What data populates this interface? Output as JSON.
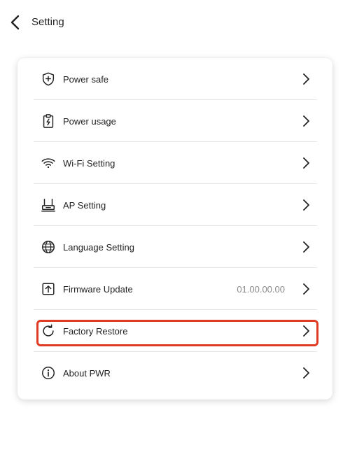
{
  "header": {
    "title": "Setting",
    "back_icon": "chevron-left-icon"
  },
  "settings": {
    "items": [
      {
        "label": "Power safe",
        "icon": "shield-plus-icon"
      },
      {
        "label": "Power usage",
        "icon": "clipboard-bolt-icon"
      },
      {
        "label": "Wi-Fi Setting",
        "icon": "wifi-icon"
      },
      {
        "label": "AP Setting",
        "icon": "router-icon"
      },
      {
        "label": "Language Setting",
        "icon": "globe-icon"
      },
      {
        "label": "Firmware Update",
        "icon": "upload-icon",
        "value": "01.00.00.00"
      },
      {
        "label": "Factory Restore",
        "icon": "refresh-icon",
        "highlighted": true
      },
      {
        "label": "About PWR",
        "icon": "info-icon"
      }
    ]
  },
  "colors": {
    "highlight": "#e03a24",
    "divider": "#e6e6e6",
    "value_text": "#8a8a8a"
  }
}
